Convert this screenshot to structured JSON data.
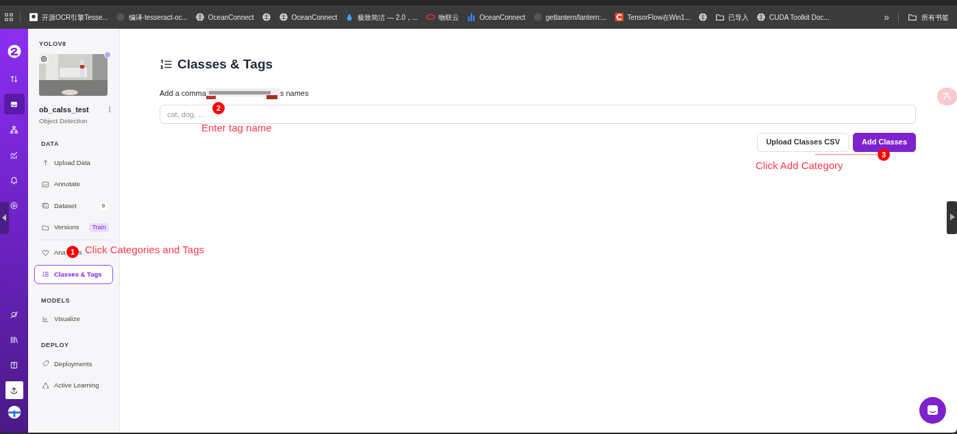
{
  "bookmarks_bar": {
    "items": [
      {
        "label": "开源OCR引擎Tesse...",
        "kind": "avatar"
      },
      {
        "label": "编译·tesseract-oc...",
        "kind": "github"
      },
      {
        "label": "OceanConnect",
        "kind": "globe"
      },
      {
        "kind": "globe"
      },
      {
        "label": "OceanConnect",
        "kind": "globe"
      },
      {
        "label": "极致简洁 — 2.0，...",
        "kind": "drop"
      },
      {
        "label": "物联云",
        "kind": "cloud"
      },
      {
        "label": "OceanConnect",
        "kind": "bars"
      },
      {
        "label": "getlantern/lantern:...",
        "kind": "github"
      },
      {
        "label": "TensorFlow在Win1...",
        "kind": "c"
      },
      {
        "kind": "globe"
      },
      {
        "label": "已导入",
        "kind": "folder"
      },
      {
        "label": "CUDA Toolkit Doc...",
        "kind": "globe"
      }
    ],
    "overflow": "»",
    "all_bookmarks": "所有书签"
  },
  "rail": {
    "items": [
      {
        "selected": false
      },
      {
        "selected": true
      },
      {
        "selected": false
      },
      {
        "selected": false
      },
      {
        "selected": false
      },
      {
        "selected": false
      }
    ]
  },
  "sidebar": {
    "workspace": "YOLOV8",
    "project": "ob_calss_test",
    "project_type": "Object Detection",
    "sections": [
      {
        "title": "DATA",
        "items": [
          {
            "label": "Upload Data",
            "selected": false
          },
          {
            "label": "Annotate",
            "selected": false
          },
          {
            "label": "Dataset",
            "selected": false,
            "badge": "0"
          },
          {
            "label": "Versions",
            "selected": false,
            "tag": "Train"
          },
          {
            "label": "Ana",
            "label_end": "s",
            "selected": false
          },
          {
            "label": "Classes & Tags",
            "selected": true
          }
        ]
      },
      {
        "title": "MODELS",
        "items": [
          {
            "label": "Visualize",
            "selected": false
          }
        ]
      },
      {
        "title": "DEPLOY",
        "items": [
          {
            "label": "Deployments",
            "selected": false
          },
          {
            "label": "Active Learning",
            "selected": false
          }
        ]
      }
    ]
  },
  "main": {
    "title": "Classes & Tags",
    "field_label": "Add a comma",
    "field_label_end": "s names",
    "placeholder": "cat, dog, ...",
    "buttons": [
      {
        "label": "Upload Classes CSV",
        "kind": "secondary"
      },
      {
        "label": "Add Classes",
        "kind": "primary"
      }
    ]
  },
  "annotations": [
    {
      "number": "1",
      "text": "Click Categories and Tags"
    },
    {
      "number": "2",
      "text": "Enter tag name"
    },
    {
      "number": "3",
      "text": "Click Add Category"
    }
  ]
}
